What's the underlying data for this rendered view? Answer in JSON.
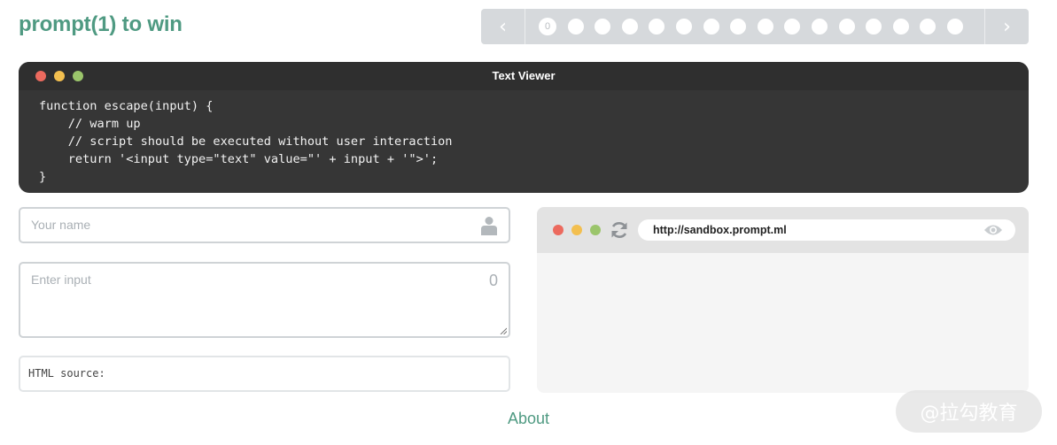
{
  "header": {
    "title": "prompt(1) to win"
  },
  "pager": {
    "prev_icon": "chevron-left-icon",
    "next_icon": "chevron-right-icon",
    "prev_glyph": "‹",
    "next_glyph": "›",
    "active_label": "0",
    "dot_count": 16
  },
  "viewer": {
    "title": "Text Viewer",
    "code": "function escape(input) {\n    // warm up\n    // script should be executed without user interaction\n    return '<input type=\"text\" value=\"' + input + '\">';\n}"
  },
  "form": {
    "name_placeholder": "Your name",
    "input_placeholder": "Enter input",
    "input_count": "0",
    "source_label": "HTML source:"
  },
  "browser": {
    "url": "http://sandbox.prompt.ml"
  },
  "footer": {
    "about_label": "About"
  },
  "watermark": {
    "text": "@拉勾教育"
  },
  "colors": {
    "accent": "#4f9a82",
    "viewer_bg": "#363636",
    "pager_bg": "#d6d9dc",
    "traffic_red": "#ec6a5e",
    "traffic_yellow": "#f3bf4f",
    "traffic_green": "#9bc56b"
  }
}
